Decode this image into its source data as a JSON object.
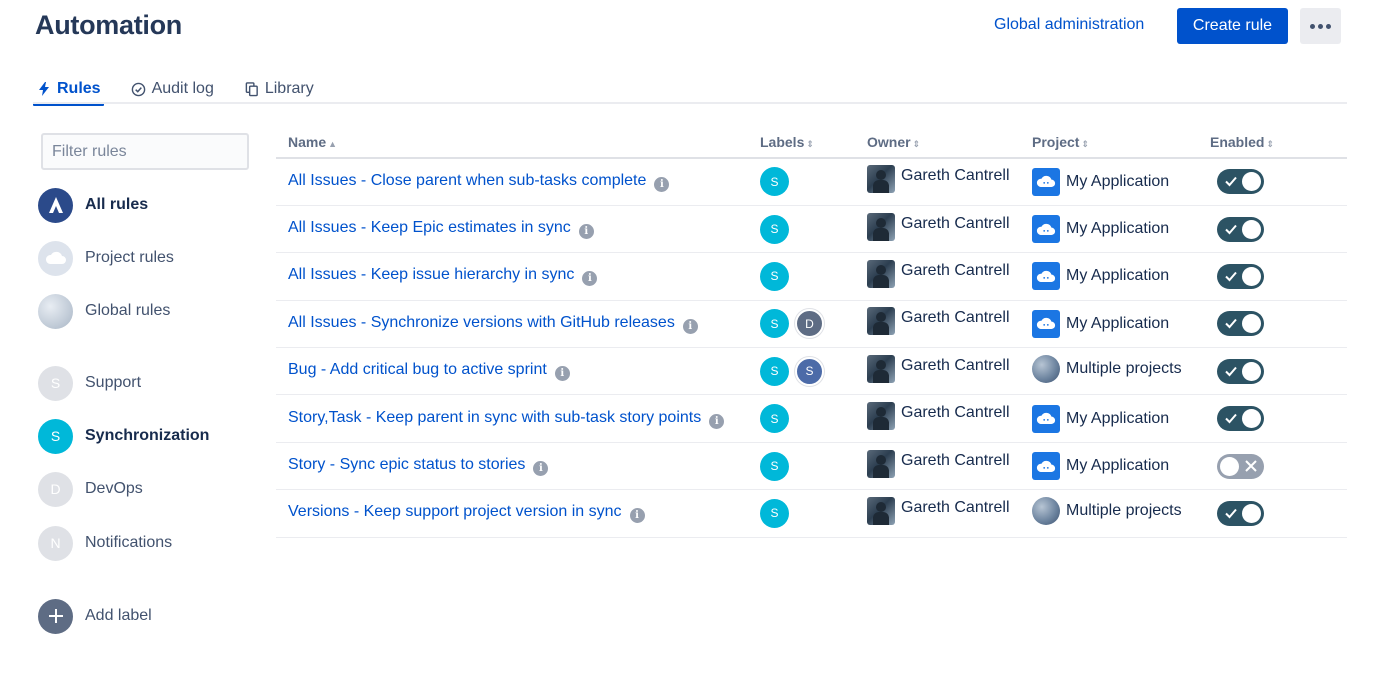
{
  "header": {
    "title": "Automation",
    "global_admin": "Global administration",
    "create_rule": "Create rule"
  },
  "tabs": [
    {
      "label": "Rules",
      "icon": "bolt-icon",
      "active": true
    },
    {
      "label": "Audit log",
      "icon": "check-circle-icon",
      "active": false
    },
    {
      "label": "Library",
      "icon": "copy-icon",
      "active": false
    }
  ],
  "sidebar": {
    "filter_placeholder": "Filter rules",
    "items": [
      {
        "label": "All rules",
        "icon": "automation-icon",
        "bold": true
      },
      {
        "label": "Project rules",
        "icon": "cloud-icon",
        "bold": false
      },
      {
        "label": "Global rules",
        "icon": "globe-icon",
        "bold": false
      },
      {
        "label": "Support",
        "letter": "S",
        "bold": false
      },
      {
        "label": "Synchronization",
        "letter": "S",
        "bold": true
      },
      {
        "label": "DevOps",
        "letter": "D",
        "bold": false
      },
      {
        "label": "Notifications",
        "letter": "N",
        "bold": false
      },
      {
        "label": "Add label",
        "icon": "plus-icon",
        "bold": false
      }
    ]
  },
  "table": {
    "columns": {
      "name": "Name",
      "labels": "Labels",
      "owner": "Owner",
      "project": "Project",
      "enabled": "Enabled"
    },
    "rows": [
      {
        "name": "All Issues - Close parent when sub-tasks complete",
        "labels": [
          "S"
        ],
        "owner": "Gareth Cantrell",
        "project": "My Application",
        "project_type": "app",
        "enabled": true
      },
      {
        "name": "All Issues - Keep Epic estimates in sync",
        "labels": [
          "S"
        ],
        "owner": "Gareth Cantrell",
        "project": "My Application",
        "project_type": "app",
        "enabled": true
      },
      {
        "name": "All Issues - Keep issue hierarchy in sync",
        "labels": [
          "S"
        ],
        "owner": "Gareth Cantrell",
        "project": "My Application",
        "project_type": "app",
        "enabled": true
      },
      {
        "name": "All Issues - Synchronize versions with GitHub releases",
        "labels": [
          "S",
          "D"
        ],
        "owner": "Gareth Cantrell",
        "project": "My Application",
        "project_type": "app",
        "enabled": true
      },
      {
        "name": "Bug - Add critical bug to active sprint",
        "labels": [
          "S",
          "S"
        ],
        "owner": "Gareth Cantrell",
        "project": "Multiple projects",
        "project_type": "multi",
        "enabled": true
      },
      {
        "name": "Story,Task - Keep parent in sync with sub-task story points",
        "labels": [
          "S"
        ],
        "owner": "Gareth Cantrell",
        "project": "My Application",
        "project_type": "app",
        "enabled": true
      },
      {
        "name": "Story - Sync epic status to stories",
        "labels": [
          "S"
        ],
        "owner": "Gareth Cantrell",
        "project": "My Application",
        "project_type": "app",
        "enabled": false
      },
      {
        "name": "Versions - Keep support project version in sync",
        "labels": [
          "S"
        ],
        "owner": "Gareth Cantrell",
        "project": "Multiple projects",
        "project_type": "multi",
        "enabled": true
      }
    ]
  },
  "colors": {
    "primary": "#0052CC",
    "sync_label": "#00B8D9",
    "devops_label": "#5E6C84",
    "support_label": "#5E6C84",
    "toggle_on": "#2C5364",
    "toggle_off": "#97A0AF"
  }
}
